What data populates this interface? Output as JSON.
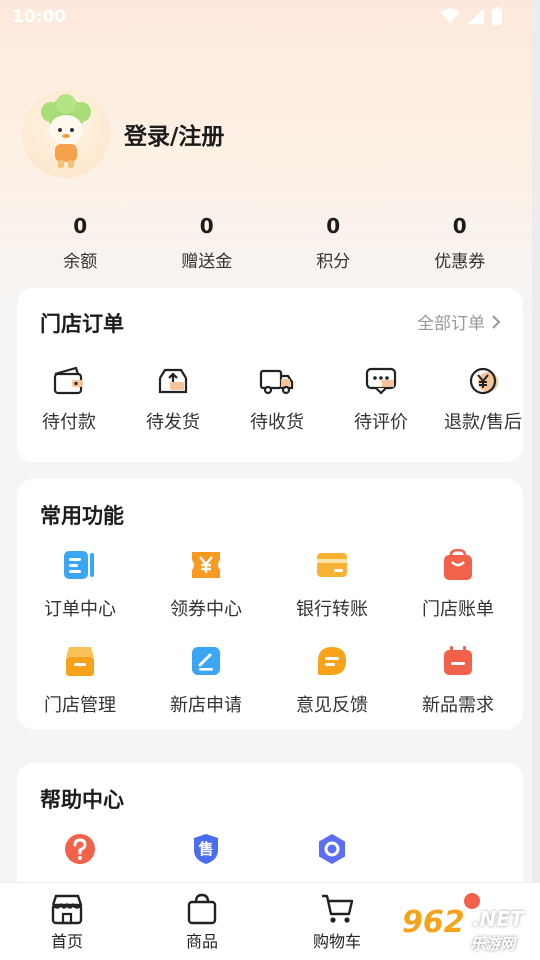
{
  "status_bar": {
    "time": "10:00"
  },
  "profile": {
    "login_text": "登录/注册"
  },
  "stats": [
    {
      "value": "0",
      "label": "余额"
    },
    {
      "value": "0",
      "label": "赠送金"
    },
    {
      "value": "0",
      "label": "积分"
    },
    {
      "value": "0",
      "label": "优惠券"
    }
  ],
  "store_orders": {
    "title": "门店订单",
    "all_orders": "全部订单",
    "items": [
      {
        "label": "待付款",
        "icon": "wallet-icon"
      },
      {
        "label": "待发货",
        "icon": "ship-box-icon"
      },
      {
        "label": "待收货",
        "icon": "truck-icon"
      },
      {
        "label": "待评价",
        "icon": "comment-icon"
      },
      {
        "label": "退款/售后",
        "icon": "yen-refund-icon"
      }
    ]
  },
  "common_functions": {
    "title": "常用功能",
    "items": [
      {
        "label": "订单中心",
        "icon": "order-list-icon",
        "color": "#3aa6f5"
      },
      {
        "label": "领券中心",
        "icon": "coupon-icon",
        "color": "#f79a1f"
      },
      {
        "label": "银行转账",
        "icon": "bank-card-icon",
        "color": "#f9b233"
      },
      {
        "label": "门店账单",
        "icon": "shopping-bag-icon",
        "color": "#f2614a"
      },
      {
        "label": "门店管理",
        "icon": "store-icon",
        "color": "#f7a21b"
      },
      {
        "label": "新店申请",
        "icon": "edit-icon",
        "color": "#3aa6f5"
      },
      {
        "label": "意见反馈",
        "icon": "feedback-icon",
        "color": "#f7a21b"
      },
      {
        "label": "新品需求",
        "icon": "calendar-icon",
        "color": "#f2614a"
      }
    ]
  },
  "help_center": {
    "title": "帮助中心",
    "items": [
      {
        "icon": "question-icon",
        "color": "#f2614a"
      },
      {
        "icon": "shield-icon",
        "glyph": "售",
        "color": "#4a6cf0"
      },
      {
        "icon": "ring-icon",
        "color": "#5b6ef5"
      }
    ]
  },
  "tabbar": [
    {
      "label": "首页",
      "icon": "home-store-icon"
    },
    {
      "label": "商品",
      "icon": "bag-icon"
    },
    {
      "label": "购物车",
      "icon": "cart-icon"
    }
  ],
  "watermark": {
    "text1": "962",
    "text2": ".NET",
    "text3": "乐游网"
  }
}
